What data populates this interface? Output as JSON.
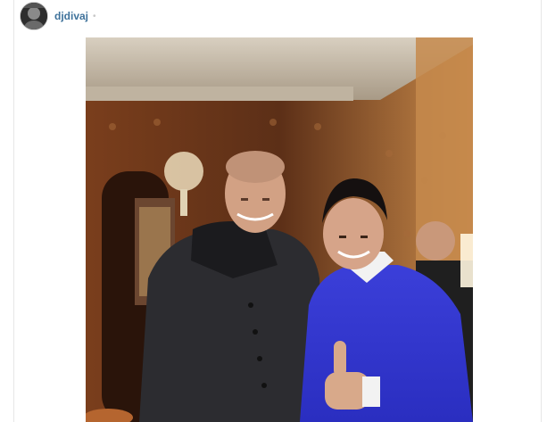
{
  "post": {
    "username": "djdivaj",
    "separator": "•"
  },
  "icons": {
    "avatar": "user-avatar"
  },
  "photo": {
    "subject": "post-image"
  }
}
